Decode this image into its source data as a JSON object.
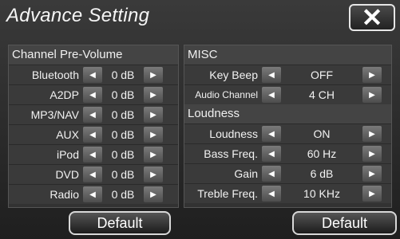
{
  "title": "Advance Setting",
  "close_glyph": "✕",
  "left_panel": {
    "title": "Channel Pre-Volume",
    "rows": [
      {
        "label": "Bluetooth",
        "value": "0 dB"
      },
      {
        "label": "A2DP",
        "value": "0 dB"
      },
      {
        "label": "MP3/NAV",
        "value": "0 dB"
      },
      {
        "label": "AUX",
        "value": "0 dB"
      },
      {
        "label": "iPod",
        "value": "0 dB"
      },
      {
        "label": "DVD",
        "value": "0 dB"
      },
      {
        "label": "Radio",
        "value": "0 dB"
      }
    ]
  },
  "right_panel": {
    "misc_title": "MISC",
    "misc_rows": [
      {
        "label": "Key Beep",
        "value": "OFF"
      },
      {
        "label": "Audio Channel",
        "value": "4 CH"
      }
    ],
    "loudness_title": "Loudness",
    "loudness_rows": [
      {
        "label": "Loudness",
        "value": "ON"
      },
      {
        "label": "Bass Freq.",
        "value": "60 Hz"
      },
      {
        "label": "Gain",
        "value": "6 dB"
      },
      {
        "label": "Treble Freq.",
        "value": "10 KHz"
      }
    ]
  },
  "buttons": {
    "default_left": "Default",
    "default_right": "Default"
  },
  "arrows": {
    "left": "◀",
    "right": "▶"
  }
}
